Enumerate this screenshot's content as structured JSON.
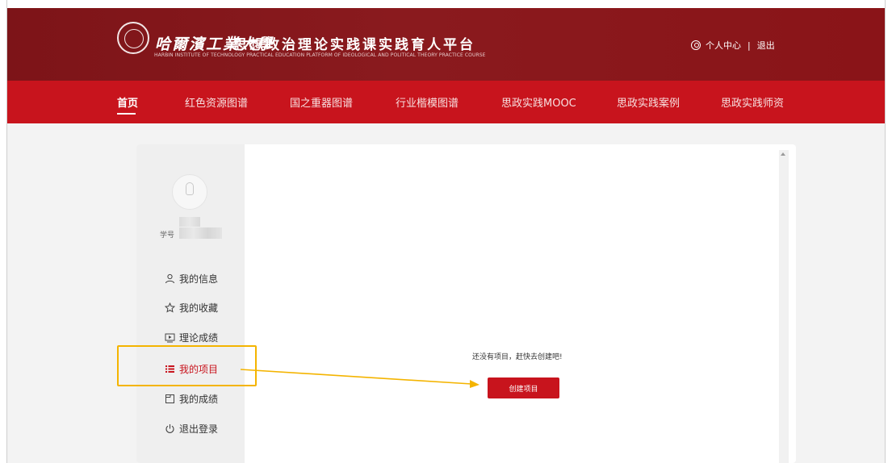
{
  "header": {
    "school_name": "哈爾濱工業大學",
    "platform_title": "思想政治理论实践课实践育人平台",
    "english_subtitle": "HARBIN INSTITUTE OF TECHNOLOGY PRACTICAL EDUCATION PLATFORM OF IDEOLOGICAL AND POLITICAL THEORY PRACTICE COURSE",
    "user_center": "个人中心",
    "separator": "|",
    "logout": "退出"
  },
  "nav": {
    "items": [
      {
        "label": "首页",
        "active": true
      },
      {
        "label": "红色资源图谱"
      },
      {
        "label": "国之重器图谱"
      },
      {
        "label": "行业楷模图谱"
      },
      {
        "label": "思政实践MOOC"
      },
      {
        "label": "思政实践案例"
      },
      {
        "label": "思政实践师资"
      }
    ]
  },
  "profile": {
    "student_id_label": "学号"
  },
  "sidebar": {
    "items": [
      {
        "label": "我的信息",
        "icon": "user-icon"
      },
      {
        "label": "我的收藏",
        "icon": "star-icon"
      },
      {
        "label": "理论成绩",
        "icon": "video-icon"
      },
      {
        "label": "我的项目",
        "icon": "list-icon",
        "active": true
      },
      {
        "label": "我的成绩",
        "icon": "folder-icon"
      },
      {
        "label": "退出登录",
        "icon": "power-icon"
      }
    ]
  },
  "main": {
    "empty_message": "还没有项目，赶快去创建吧!",
    "create_button": "创建项目"
  },
  "colors": {
    "brand_dark": "#8a1418",
    "brand_red": "#c8141d",
    "highlight": "#f4b400"
  }
}
